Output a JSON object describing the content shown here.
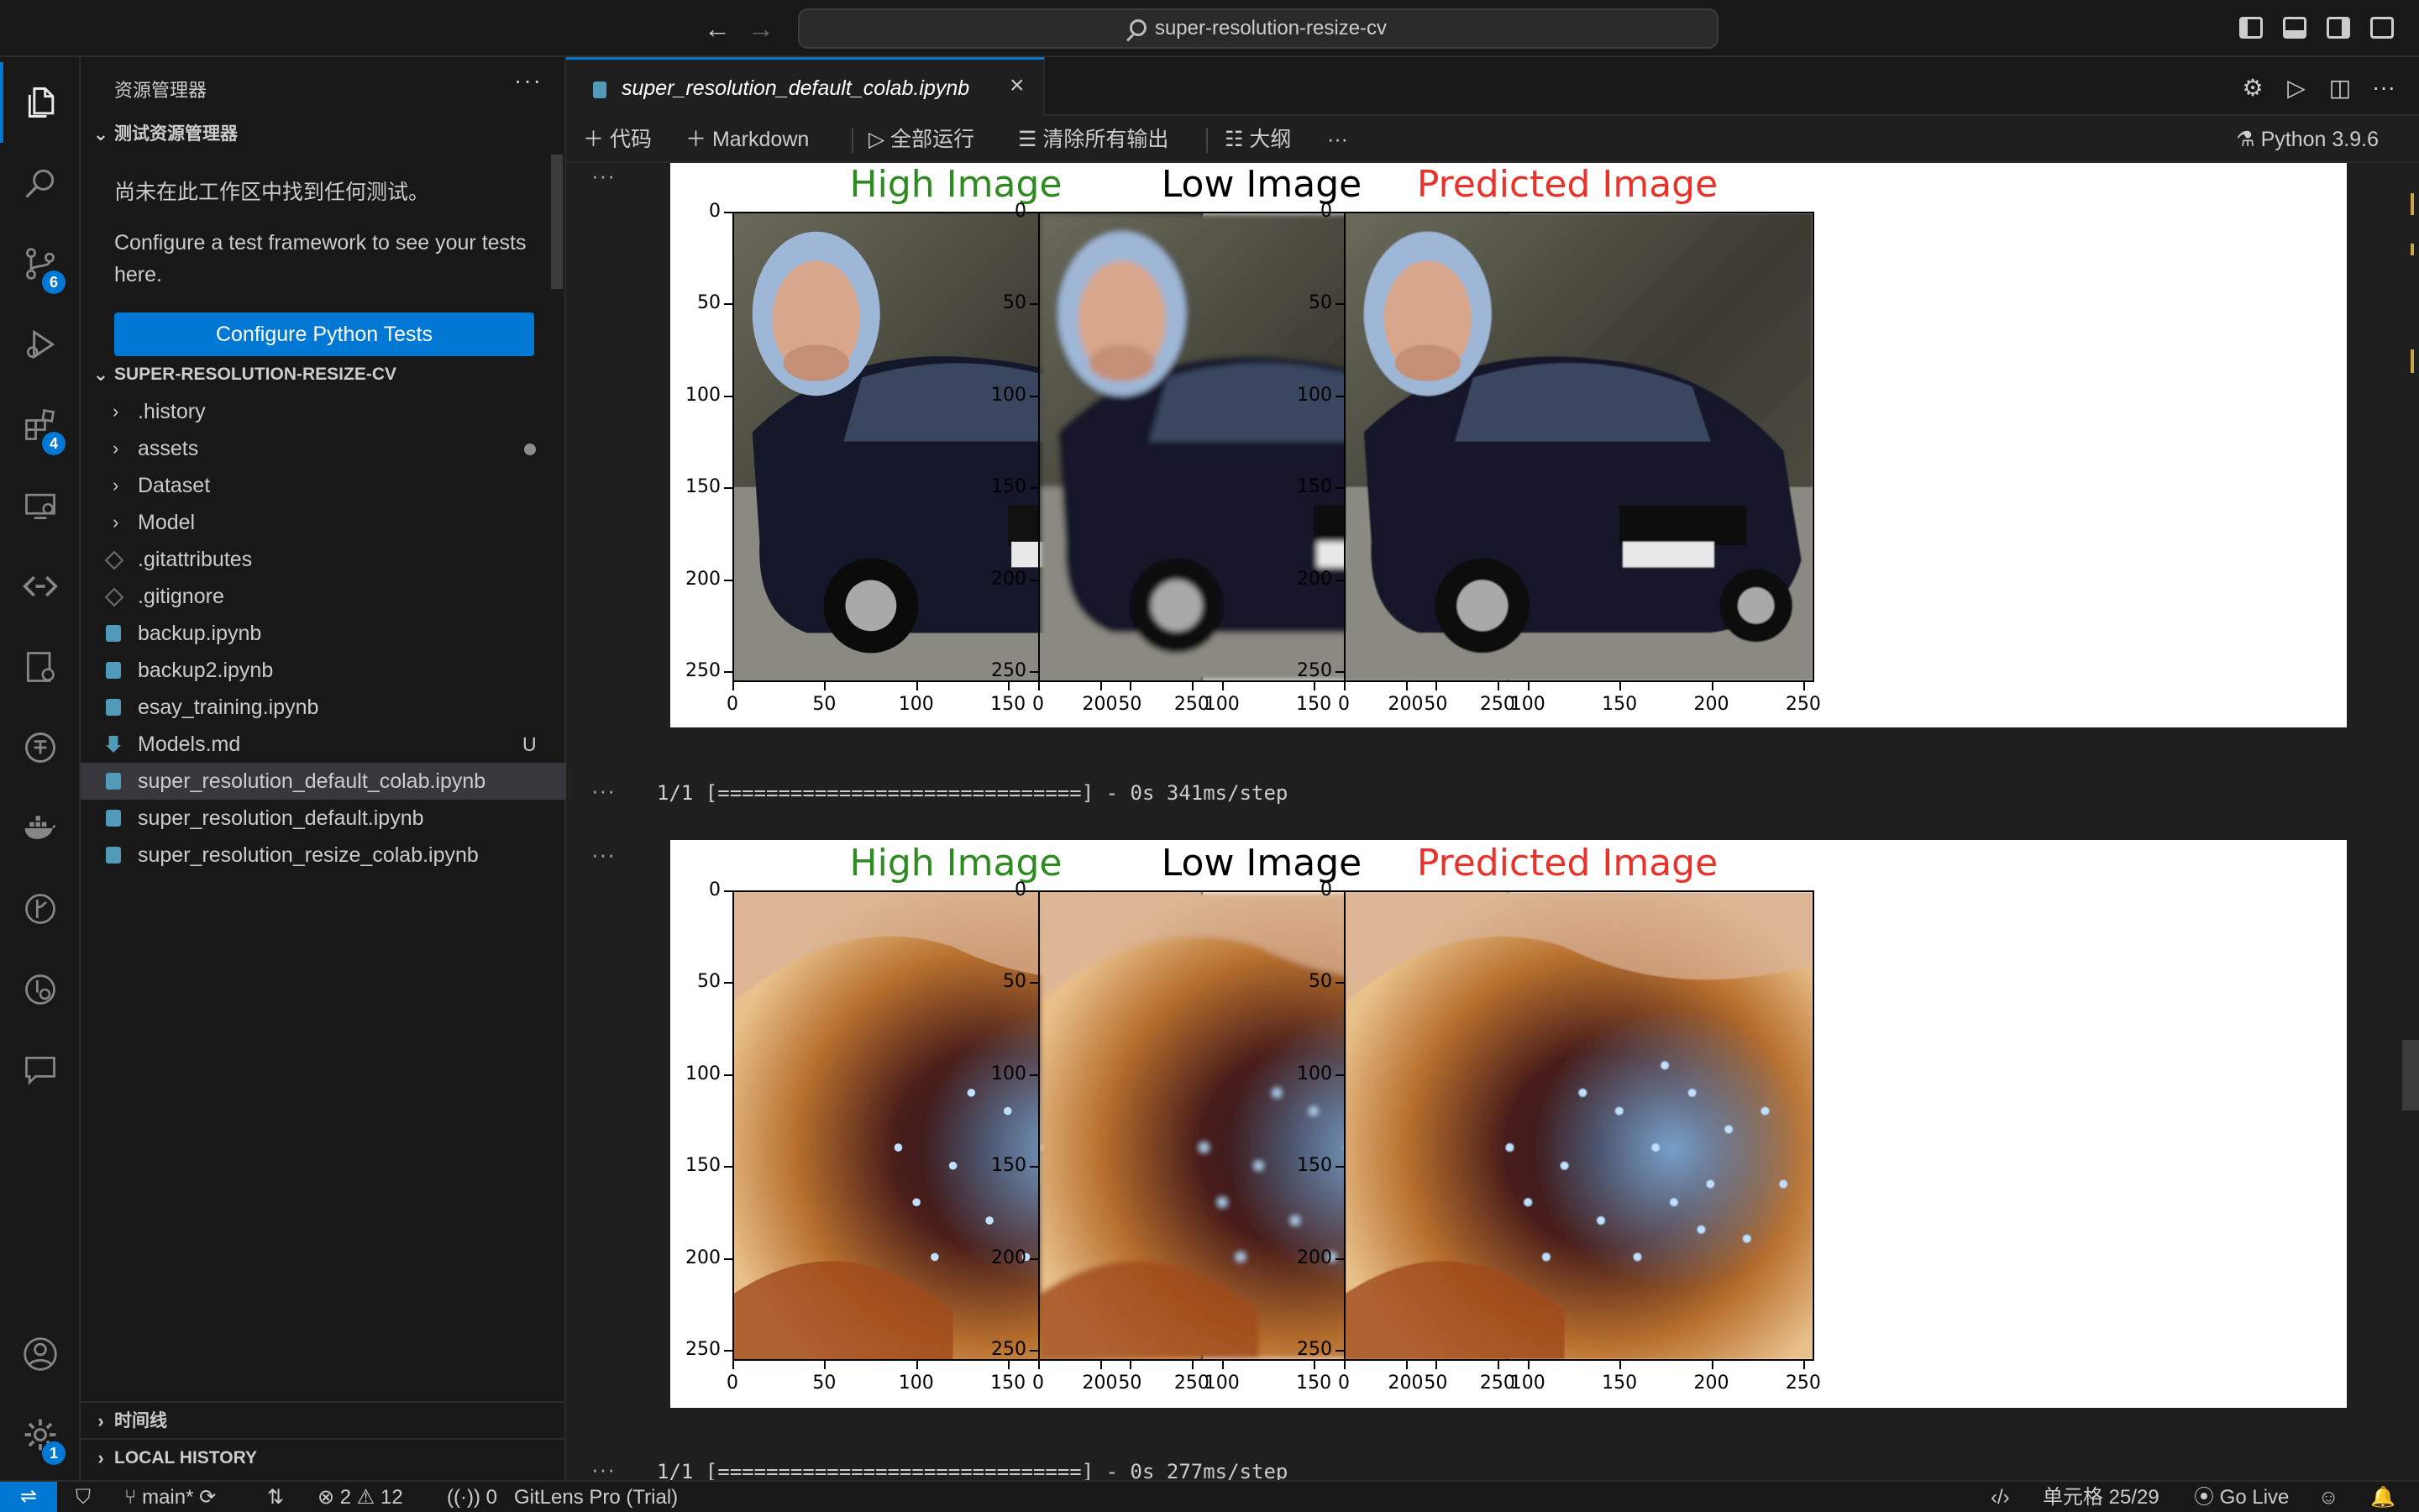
{
  "titlebar": {
    "back": "←",
    "forward": "→",
    "search_text": "super-resolution-resize-cv"
  },
  "activity_bar": {
    "items": [
      {
        "name": "explorer-icon",
        "badge": ""
      },
      {
        "name": "search-icon",
        "badge": ""
      },
      {
        "name": "source-control-icon",
        "badge": "6"
      },
      {
        "name": "run-debug-icon",
        "badge": ""
      },
      {
        "name": "extensions-icon",
        "badge": "4"
      },
      {
        "name": "remote-explorer-icon",
        "badge": ""
      },
      {
        "name": "code-icon",
        "badge": ""
      },
      {
        "name": "testing-icon",
        "badge": ""
      },
      {
        "name": "database-icon",
        "badge": ""
      },
      {
        "name": "docker-icon",
        "badge": ""
      },
      {
        "name": "git-graph-icon",
        "badge": ""
      },
      {
        "name": "gitlens-icon",
        "badge": ""
      },
      {
        "name": "comments-icon",
        "badge": ""
      }
    ],
    "account_icon": "account-icon",
    "settings_badge": "1"
  },
  "sidebar": {
    "title": "资源管理器",
    "more": "···",
    "test_section": {
      "title": "测试资源管理器",
      "message_1": "尚未在此工作区中找到任何测试。",
      "message_2": "Configure a test framework to see your tests here.",
      "button": "Configure Python Tests"
    },
    "folder_section": {
      "title": "SUPER-RESOLUTION-RESIZE-CV",
      "items": [
        {
          "label": ".history",
          "type": "folder",
          "badge": ""
        },
        {
          "label": "assets",
          "type": "folder",
          "badge": "dot"
        },
        {
          "label": "Dataset",
          "type": "folder",
          "badge": ""
        },
        {
          "label": "Model",
          "type": "folder",
          "badge": ""
        },
        {
          "label": ".gitattributes",
          "type": "git",
          "badge": ""
        },
        {
          "label": ".gitignore",
          "type": "git",
          "badge": ""
        },
        {
          "label": "backup.ipynb",
          "type": "notebook",
          "badge": ""
        },
        {
          "label": "backup2.ipynb",
          "type": "notebook",
          "badge": ""
        },
        {
          "label": "esay_training.ipynb",
          "type": "notebook",
          "badge": ""
        },
        {
          "label": "Models.md",
          "type": "markdown",
          "badge": "U"
        },
        {
          "label": "super_resolution_default_colab.ipynb",
          "type": "notebook",
          "badge": "",
          "selected": true
        },
        {
          "label": "super_resolution_default.ipynb",
          "type": "notebook",
          "badge": ""
        },
        {
          "label": "super_resolution_resize_colab.ipynb",
          "type": "notebook",
          "badge": ""
        }
      ]
    },
    "timeline": "时间线",
    "local_history": "LOCAL HISTORY"
  },
  "editor": {
    "tab_label": "super_resolution_default_colab.ipynb",
    "toolbar": {
      "code": "代码",
      "markdown": "Markdown",
      "run_all": "全部运行",
      "clear_outputs": "清除所有输出",
      "outline": "大纲",
      "more": "···",
      "kernel": "Python 3.9.6"
    },
    "outputs": [
      {
        "titles": [
          "High Image",
          "Low Image",
          "Predicted Image"
        ],
        "title_colors": [
          "#2e8b22",
          "#000000",
          "#e8332a"
        ],
        "image": "car"
      },
      {
        "stdout": "1/1 [==============================] - 0s 341ms/step"
      },
      {
        "titles": [
          "High Image",
          "Low Image",
          "Predicted Image"
        ],
        "title_colors": [
          "#2e8b22",
          "#000000",
          "#e8332a"
        ],
        "image": "nebula"
      },
      {
        "stdout": "1/1 [==============================] - 0s 277ms/step"
      }
    ],
    "axis_ticks": [
      "0",
      "50",
      "100",
      "150",
      "200",
      "250"
    ],
    "cell_ellipsis": "···"
  },
  "statusbar": {
    "branch": "main*",
    "errors": "2",
    "warnings": "12",
    "ports": "0",
    "gitlens": "GitLens Pro (Trial)",
    "cell_position": "单元格 25/29",
    "go_live": "Go Live"
  }
}
